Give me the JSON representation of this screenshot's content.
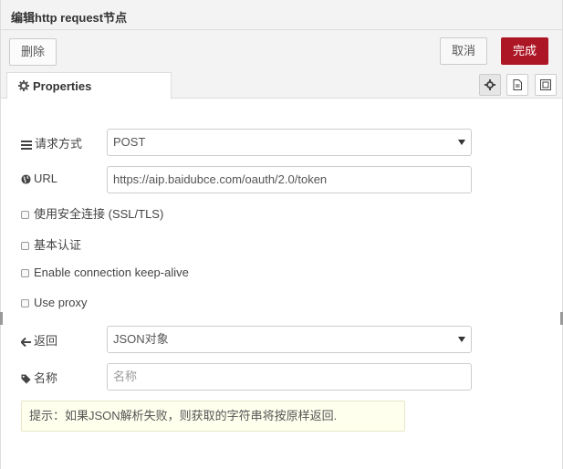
{
  "header": {
    "title": "编辑http request节点"
  },
  "toolbar": {
    "delete_label": "删除",
    "cancel_label": "取消",
    "done_label": "完成"
  },
  "tabs": {
    "properties_label": "Properties",
    "tab_icons": [
      "gear-icon",
      "document-icon",
      "frame-icon"
    ]
  },
  "form": {
    "method": {
      "label": "请求方式",
      "value": "POST"
    },
    "url": {
      "label": "URL",
      "value": "https://aip.baidubce.com/oauth/2.0/token"
    },
    "tls": {
      "label": "使用安全连接 (SSL/TLS)",
      "checked": false
    },
    "basic_auth": {
      "label": "基本认证",
      "checked": false
    },
    "keep_alive": {
      "label": "Enable connection keep-alive",
      "checked": false
    },
    "use_proxy": {
      "label": "Use proxy",
      "checked": false
    },
    "return": {
      "label": "返回",
      "value": "JSON对象"
    },
    "name": {
      "label": "名称",
      "placeholder": "名称",
      "value": ""
    }
  },
  "tip": "提示：如果JSON解析失败，则获取的字符串将按原样返回.",
  "colors": {
    "accent": "#ad1625",
    "tip_bg": "#ffffee",
    "header_bg": "#f3f3f3"
  }
}
